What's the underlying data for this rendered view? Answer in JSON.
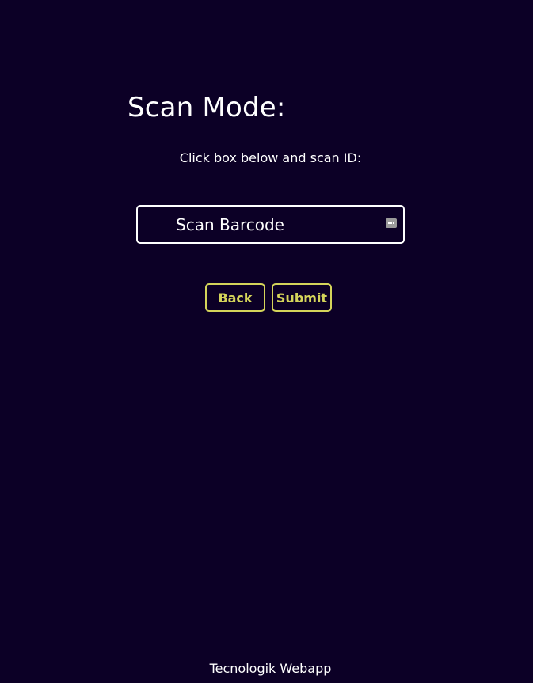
{
  "page": {
    "title": "Scan Mode:",
    "instruction": "Click box below and scan ID:"
  },
  "scan": {
    "placeholder": "Scan Barcode",
    "value": ""
  },
  "actions": {
    "back_label": "Back",
    "submit_label": "Submit"
  },
  "footer": {
    "text": "Tecnologik Webapp"
  },
  "icons": {
    "input_menu": "more-dots-icon"
  },
  "colors": {
    "background": "#0c0026",
    "text": "#ffffff",
    "accent": "#d4d45a"
  }
}
